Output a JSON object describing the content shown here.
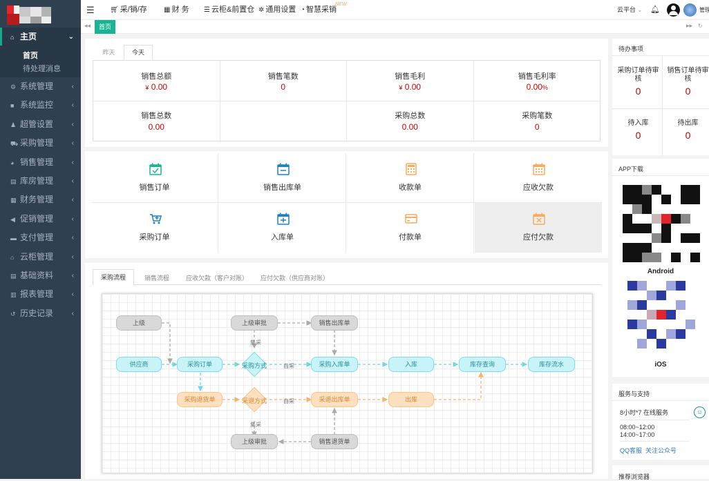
{
  "topnav": {
    "items": [
      {
        "icon": "cart-icon",
        "label": "采/销/存"
      },
      {
        "icon": "calculator-icon",
        "label": "财 务"
      },
      {
        "icon": "database-icon",
        "label": "云柜&前置仓"
      },
      {
        "icon": "gear-icon",
        "label": "通用设置"
      },
      {
        "icon": "pie-chart-icon",
        "label": "智慧采销"
      }
    ],
    "new_badge": "NEW",
    "cloud_platform": "云平台",
    "admin_label": "管理"
  },
  "tabs": {
    "home": "首页"
  },
  "sidebar": {
    "home": "主页",
    "home_sub": [
      "首页",
      "待处理消息"
    ],
    "items": [
      {
        "icon": "gear-icon",
        "label": "系统管理"
      },
      {
        "icon": "video-icon",
        "label": "系统监控"
      },
      {
        "icon": "users-icon",
        "label": "超管设置"
      },
      {
        "icon": "cart-icon",
        "label": "采购管理"
      },
      {
        "icon": "pie-icon",
        "label": "销售管理"
      },
      {
        "icon": "book-icon",
        "label": "库房管理"
      },
      {
        "icon": "calculator-icon",
        "label": "财务管理"
      },
      {
        "icon": "bullhorn-icon",
        "label": "促销管理"
      },
      {
        "icon": "card-icon",
        "label": "支付管理"
      },
      {
        "icon": "bank-icon",
        "label": "云柜管理"
      },
      {
        "icon": "book-icon",
        "label": "基础资料"
      },
      {
        "icon": "bar-chart-icon",
        "label": "报表管理"
      },
      {
        "icon": "history-icon",
        "label": "历史记录"
      }
    ]
  },
  "stats": {
    "day_tabs": [
      "昨天",
      "今天"
    ],
    "row1": [
      {
        "label": "销售总额",
        "prefix": "¥",
        "value": "0.00",
        "suffix": ""
      },
      {
        "label": "销售笔数",
        "prefix": "",
        "value": "0",
        "suffix": ""
      },
      {
        "label": "销售毛利",
        "prefix": "¥",
        "value": "0.00",
        "suffix": ""
      },
      {
        "label": "销售毛利率",
        "prefix": "",
        "value": "0.00",
        "suffix": "%"
      }
    ],
    "row2": [
      {
        "label": "销售总数",
        "value": "0.00"
      },
      {
        "label": "",
        "value": ""
      },
      {
        "label": "采购总数",
        "value": "0.00"
      },
      {
        "label": "采购笔数",
        "value": "0"
      }
    ]
  },
  "actions": [
    {
      "label": "销售订单",
      "icon": "calendar-check-icon",
      "color": "#1ab394"
    },
    {
      "label": "销售出库单",
      "icon": "calendar-minus-icon",
      "color": "#1c84c6"
    },
    {
      "label": "收款单",
      "icon": "calculator-icon",
      "color": "#f8ac59"
    },
    {
      "label": "应收欠款",
      "icon": "calendar-icon",
      "color": "#f8ac59"
    },
    {
      "label": "采购订单",
      "icon": "cart-plus-icon",
      "color": "#1c84c6"
    },
    {
      "label": "入库单",
      "icon": "calendar-plus-icon",
      "color": "#1c84c6"
    },
    {
      "label": "付款单",
      "icon": "credit-card-icon",
      "color": "#f8ac59"
    },
    {
      "label": "应付欠款",
      "icon": "calendar-times-icon",
      "color": "#f8ac59"
    }
  ],
  "flow": {
    "tabs": [
      "采购流程",
      "销售流程",
      "应收欠款（客户对账）",
      "应付欠款（供应商对账）"
    ],
    "nodes": {
      "superior": "上级",
      "superior_approve_top": "上级审批",
      "sales_out_top": "销售出库单",
      "supplier": "供应商",
      "purchase_order": "采购订单",
      "purchase_method": "采购方式",
      "purchase_in": "采购入库单",
      "warehouse_in": "入库",
      "stock_query": "库存查询",
      "stock_flow": "库存流水",
      "purchase_return": "采购退货单",
      "return_method": "采退方式",
      "return_out": "采退出库单",
      "warehouse_out": "出库",
      "superior_approve_bottom": "上级审批",
      "sales_return": "销售退货单"
    },
    "edge_labels": {
      "collect_top": "集采",
      "self_top": "自采",
      "self_bottom": "自采",
      "collect_bottom": "集采"
    }
  },
  "right": {
    "todo_title": "待办事项",
    "todos": [
      {
        "label": "采购订单待审核",
        "value": "0"
      },
      {
        "label": "销售订单待审核",
        "value": "0"
      },
      {
        "label": "待入库",
        "value": "0"
      },
      {
        "label": "待出库",
        "value": "0"
      }
    ],
    "app_title": "APP下载",
    "android": "Android",
    "ios": "iOS",
    "service_title": "服务与支持",
    "service_hours": "8小时*7 在线服务",
    "time1": "08:00~12:00",
    "time2": "14:00~17:00",
    "qq": "QQ客服",
    "follow": "关注公众号",
    "browser_title": "推荐浏览器"
  }
}
